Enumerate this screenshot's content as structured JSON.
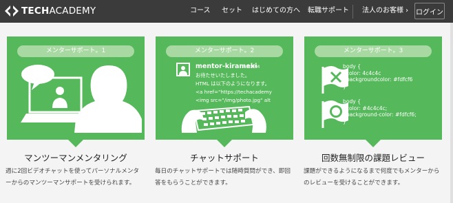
{
  "brand": {
    "logo_text_bold": "TECH",
    "logo_text_thin": "ACADEMY"
  },
  "nav": {
    "items": [
      {
        "label": "コース"
      },
      {
        "label": "セット"
      },
      {
        "label": "はじめての方へ"
      },
      {
        "label": "転職サポート"
      },
      {
        "label": "法人のお客様 ›"
      }
    ],
    "login_label": "ログイン"
  },
  "cards": [
    {
      "pill": "メンターサポート。1",
      "title": "マンツーマンメンタリング",
      "desc_line1": "週に2回ビデオチャットを使ってパーソナルメンタ",
      "desc_line2": "ーからのマンツーマンサポートを受けられます。"
    },
    {
      "pill": "メンターサポート。2",
      "title": "チャットサポート",
      "desc_line1": "毎日のチャットサポートでは随時質問ができ、即回",
      "desc_line2": "答をもらうことができます。",
      "chat": {
        "name": "mentor-kirameki",
        "time": "4:12PM",
        "lines": [
          "お待たせいたしました。",
          "HTML は以下のようになります。",
          "<a href=\"https://techacademy",
          "<img src=\"/img/photo.jpg\" alt"
        ]
      }
    },
    {
      "pill": "メンターサポート。3",
      "title": "回数無制限の課題レビュー",
      "desc_line1": "課題ができるようになるまで何度でもメンターから",
      "desc_line2": "のレビューを受けることができます。",
      "code_block_1": "body {\n  color: 4c4c4c\n  backgroundcolor: #fdfcf6\n}",
      "code_block_2": "body {\n  color: #4c4c4c;\n  background-color: #fdfcf6;\n}"
    }
  ],
  "colors": {
    "header_bg": "#3b3b3b",
    "card_green": "#55b85a",
    "pill_bg": "#a9d9a2",
    "page_bg": "#f4f4f4"
  },
  "icons": [
    "logo-chevrons-icon",
    "speech-bubble-icon",
    "monitor-mentor-icon",
    "mentor-silhouette-icon",
    "user-avatar-icon",
    "typing-hands-icon",
    "flag-x-icon",
    "flag-circle-icon"
  ]
}
